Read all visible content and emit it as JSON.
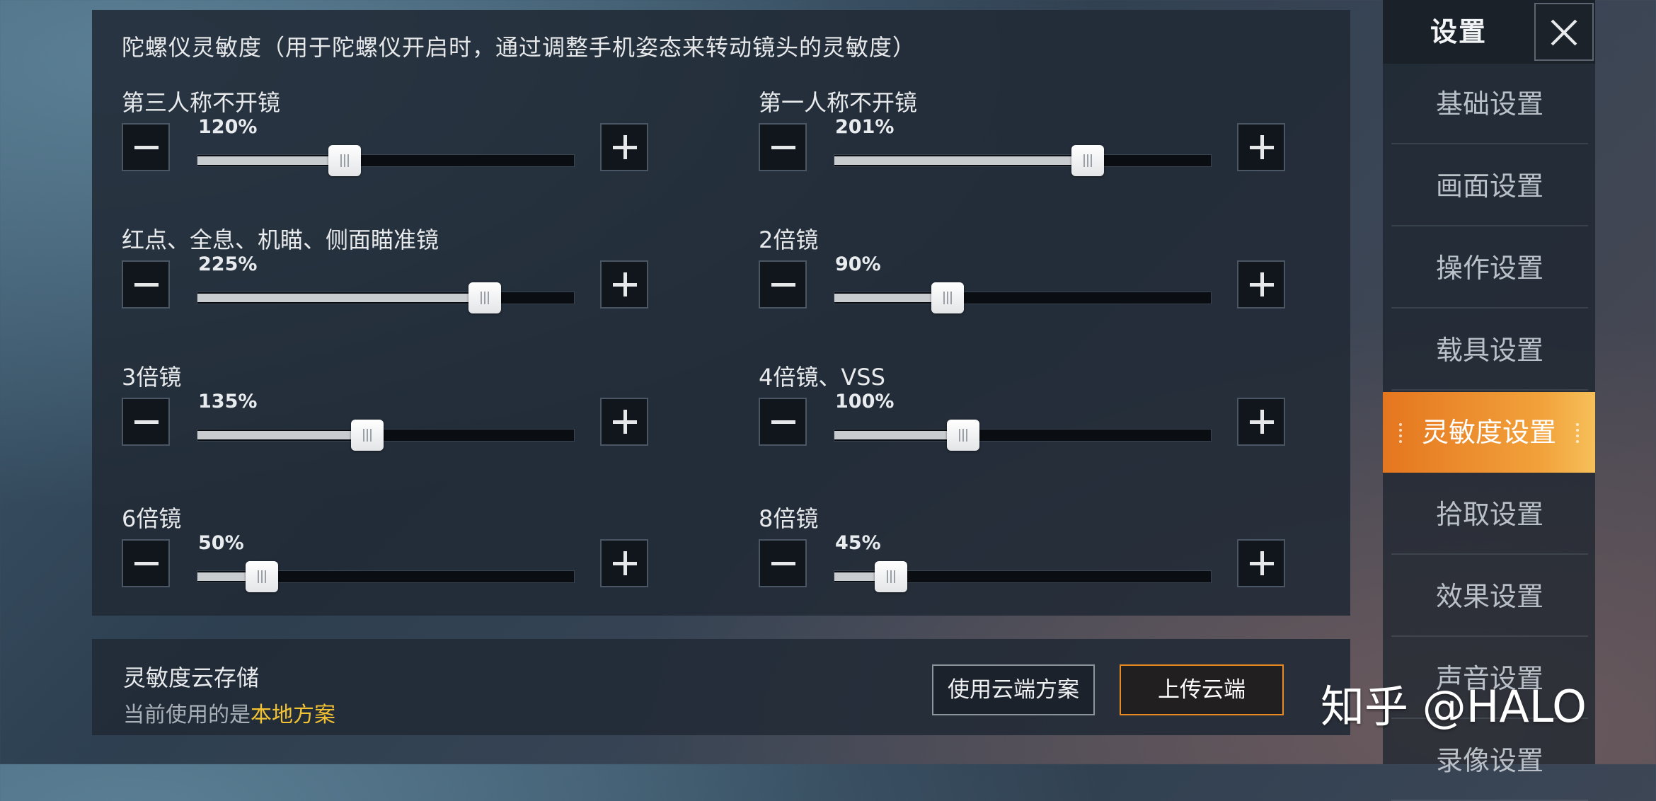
{
  "panel": {
    "title": "陀螺仪灵敏度（用于陀螺仪开启时，通过调整手机姿态来转动镜头的灵敏度）",
    "settings": [
      {
        "label": "第三人称不开镜",
        "value": "120%",
        "level": 0.39
      },
      {
        "label": "第一人称不开镜",
        "value": "201%",
        "level": 0.67
      },
      {
        "label": "红点、全息、机瞄、侧面瞄准镜",
        "value": "225%",
        "level": 0.76
      },
      {
        "label": "2倍镜",
        "value": "90%",
        "level": 0.3
      },
      {
        "label": "3倍镜",
        "value": "135%",
        "level": 0.45
      },
      {
        "label": "4倍镜、VSS",
        "value": "100%",
        "level": 0.34
      },
      {
        "label": "6倍镜",
        "value": "50%",
        "level": 0.17
      },
      {
        "label": "8倍镜",
        "value": "45%",
        "level": 0.15
      }
    ]
  },
  "cloud": {
    "title": "灵敏度云存储",
    "status_prefix": "当前使用的是",
    "status_value": "本地方案",
    "use_cloud_label": "使用云端方案",
    "upload_label": "上传云端"
  },
  "sidebar": {
    "title": "设置",
    "items": [
      {
        "label": "基础设置",
        "active": false
      },
      {
        "label": "画面设置",
        "active": false
      },
      {
        "label": "操作设置",
        "active": false
      },
      {
        "label": "载具设置",
        "active": false
      },
      {
        "label": "灵敏度设置",
        "active": true
      },
      {
        "label": "拾取设置",
        "active": false
      },
      {
        "label": "效果设置",
        "active": false
      },
      {
        "label": "声音设置",
        "active": false
      },
      {
        "label": "录像设置",
        "active": false
      }
    ]
  },
  "watermark": "知乎 @HALO",
  "colors": {
    "accent": "#f0962d",
    "highlight": "#f2c233",
    "panel": "#212a36"
  }
}
